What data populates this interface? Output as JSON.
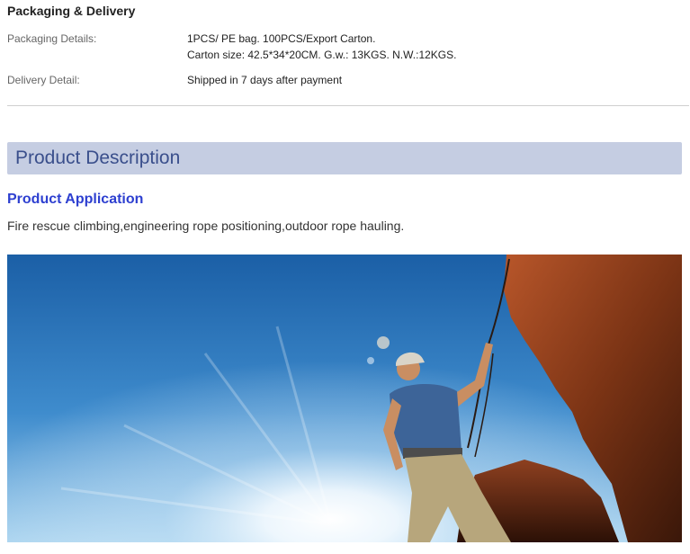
{
  "packaging": {
    "title": "Packaging & Delivery",
    "details_label": "Packaging Details:",
    "details_line1": "1PCS/ PE bag. 100PCS/Export Carton.",
    "details_line2": "Carton size: 42.5*34*20CM. G.w.: 13KGS. N.W.:12KGS.",
    "delivery_label": "Delivery Detail:",
    "delivery_value": "Shipped in 7 days after payment"
  },
  "description": {
    "bar_title": "Product Description",
    "app_heading": "Product Application",
    "app_text": "Fire rescue climbing,engineering rope positioning,outdoor rope hauling."
  },
  "photo": {
    "sky_top": "#1e63a8",
    "sky_bottom": "#9ccbea",
    "rock_color": "#8a3c1a"
  }
}
